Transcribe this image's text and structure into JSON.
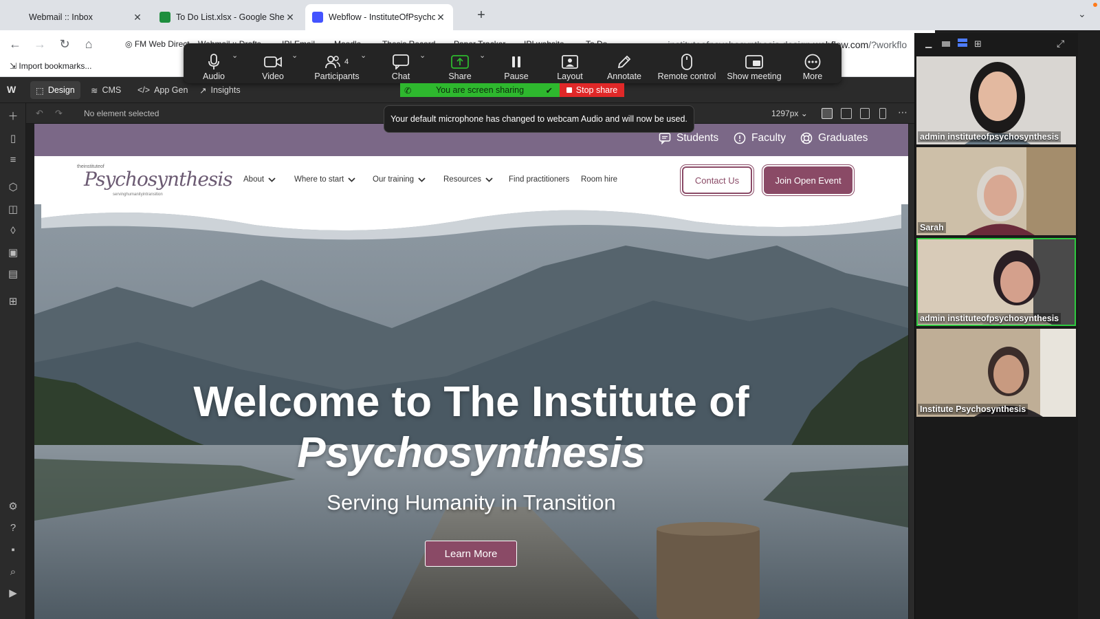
{
  "browser": {
    "tabs": [
      {
        "label": "Webmail :: Inbox",
        "active": false
      },
      {
        "label": "To Do List.xlsx - Google Sheets",
        "active": false
      },
      {
        "label": "Webflow - InstituteOfPsychosyn",
        "active": true
      }
    ],
    "new_tab_label": "+",
    "url_dim": "instituteofpsychosynthesis.design.",
    "url_main": "webflow.com",
    "url_rest": "/?workflo",
    "bookmarks": [
      "FM Web Direct",
      "Webmail :: Drafts",
      "IPI Email",
      "Moodle",
      "Thesis Record",
      "Paper Tracker",
      "IPI website",
      "To Do"
    ],
    "import_bookmarks": "Import bookmarks..."
  },
  "webflow": {
    "tabs": [
      "Design",
      "CMS",
      "App Gen",
      "Insights"
    ],
    "status": "No element selected",
    "breakpoint": "1297px"
  },
  "zoom": {
    "controls": [
      {
        "label": "Audio",
        "icon": "mic-icon"
      },
      {
        "label": "Video",
        "icon": "camera-icon"
      },
      {
        "label": "Participants",
        "icon": "people-icon",
        "count": "4"
      },
      {
        "label": "Chat",
        "icon": "chat-icon"
      },
      {
        "label": "Share",
        "icon": "share-screen-icon"
      },
      {
        "label": "Pause",
        "icon": "pause-icon"
      },
      {
        "label": "Layout",
        "icon": "layout-icon"
      },
      {
        "label": "Annotate",
        "icon": "pen-icon"
      },
      {
        "label": "Remote control",
        "icon": "mouse-icon"
      },
      {
        "label": "Show meeting",
        "icon": "show-meeting-icon"
      },
      {
        "label": "More",
        "icon": "more-icon"
      }
    ],
    "sharing_text": "You are screen sharing",
    "stop_share": "Stop share",
    "toast": "Your default microphone has changed to webcam Audio and will now be used.",
    "participants": [
      {
        "name": "admin instituteofpsychosynthesis"
      },
      {
        "name": "Sarah"
      },
      {
        "name": "admin instituteofpsychosynthesis"
      },
      {
        "name": "Institute Psychosynthesis"
      }
    ],
    "colors": {
      "sharing_green": "#2eb82e",
      "stop_red": "#e02828",
      "active_speaker": "#2ecc40"
    }
  },
  "site": {
    "top_links": [
      "Students",
      "Faculty",
      "Graduates"
    ],
    "logo": {
      "small": "theinstituteof",
      "main": "Psychosynthesis",
      "tag": "servinghumanityintransition"
    },
    "nav": [
      {
        "label": "About",
        "dropdown": true
      },
      {
        "label": "Where to start",
        "dropdown": true
      },
      {
        "label": "Our training",
        "dropdown": true
      },
      {
        "label": "Resources",
        "dropdown": true
      },
      {
        "label": "Find practitioners",
        "dropdown": false
      },
      {
        "label": "Room hire",
        "dropdown": false
      }
    ],
    "contact_button": "Contact Us",
    "join_button": "Join Open Event",
    "hero_title_line1": "Welcome to The Institute of",
    "hero_title_line2": "Psychosynthesis",
    "hero_subtitle": "Serving Humanity in Transition",
    "learn_more": "Learn More",
    "colors": {
      "brand": "#8a4a66",
      "top_strip": "#7b6887"
    }
  }
}
